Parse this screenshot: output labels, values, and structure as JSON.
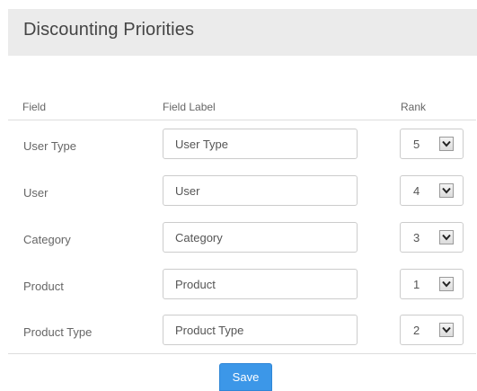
{
  "page": {
    "title": "Discounting Priorities"
  },
  "table": {
    "headers": {
      "field": "Field",
      "field_label": "Field Label",
      "rank": "Rank"
    },
    "rows": [
      {
        "field": "User Type",
        "label": "User Type",
        "rank": "5"
      },
      {
        "field": "User",
        "label": "User",
        "rank": "4"
      },
      {
        "field": "Category",
        "label": "Category",
        "rank": "3"
      },
      {
        "field": "Product",
        "label": "Product",
        "rank": "1"
      },
      {
        "field": "Product Type",
        "label": "Product Type",
        "rank": "2"
      }
    ]
  },
  "actions": {
    "save_label": "Save"
  },
  "colors": {
    "header_bg": "#ebebeb",
    "primary_button": "#3c97e8"
  },
  "icons": {
    "dropdown": "chevron-down-icon"
  }
}
